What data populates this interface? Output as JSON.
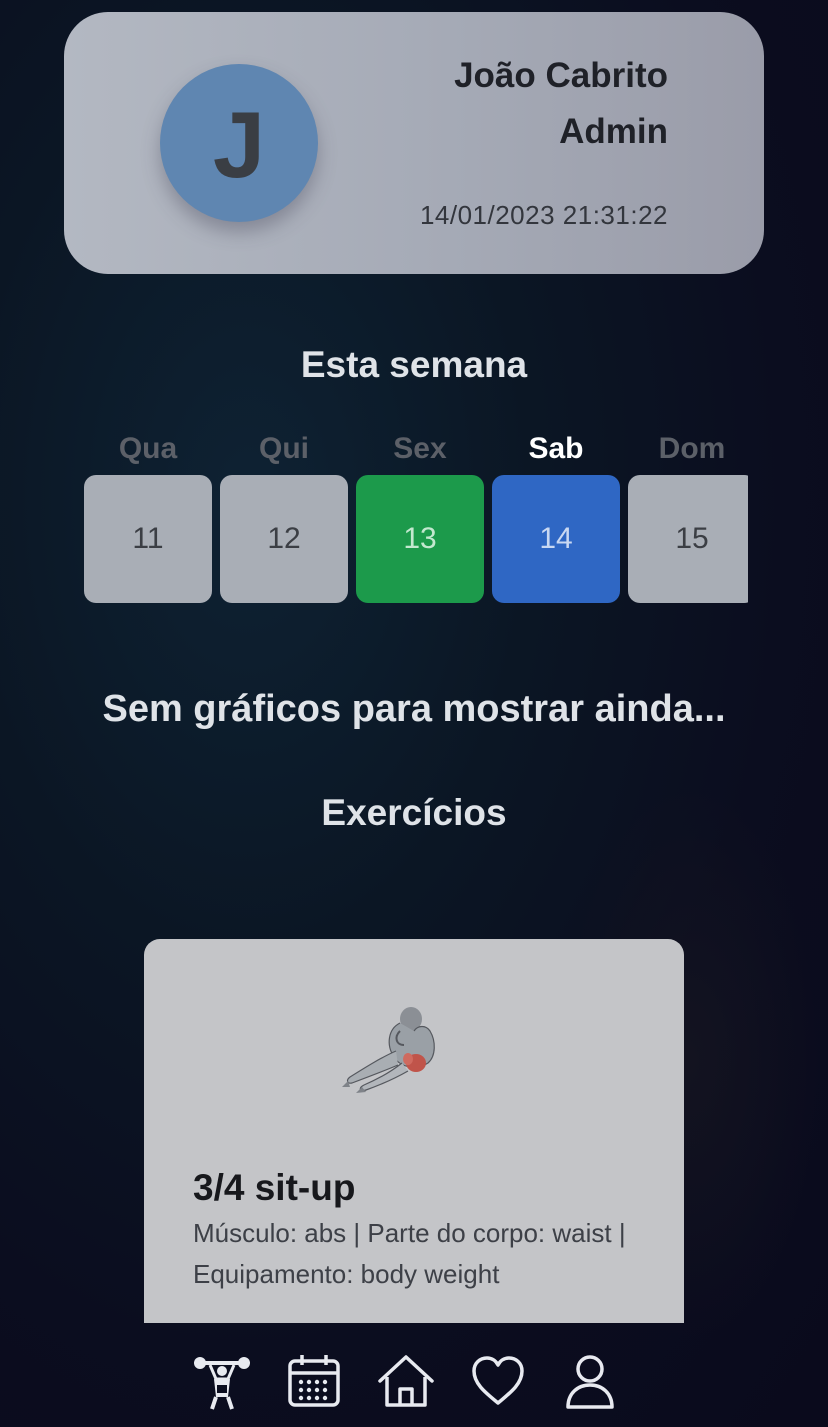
{
  "profile": {
    "initial": "J",
    "name": "João Cabrito",
    "role": "Admin",
    "datetime": "14/01/2023 21:31:22"
  },
  "week": {
    "title": "Esta semana",
    "days": [
      {
        "label": "Qua",
        "number": "11",
        "state": "default"
      },
      {
        "label": "Qui",
        "number": "12",
        "state": "default"
      },
      {
        "label": "Sex",
        "number": "13",
        "state": "done"
      },
      {
        "label": "Sab",
        "number": "14",
        "state": "today"
      },
      {
        "label": "Dom",
        "number": "15",
        "state": "default"
      }
    ]
  },
  "charts": {
    "empty_message": "Sem gráficos para mostrar ainda..."
  },
  "exercises": {
    "title": "Exercícios",
    "items": [
      {
        "name": "3/4 sit-up",
        "description": "Músculo: abs | Parte do corpo: waist | Equipamento: body weight"
      }
    ]
  },
  "nav": {
    "items": [
      {
        "icon": "weightlifter-icon",
        "active": true
      },
      {
        "icon": "calendar-icon",
        "active": false
      },
      {
        "icon": "home-icon",
        "active": false
      },
      {
        "icon": "heart-icon",
        "active": false
      },
      {
        "icon": "user-icon",
        "active": false
      }
    ]
  },
  "colors": {
    "done": "#1c9a4b",
    "today": "#2f67c4",
    "avatar": "#5f86b1"
  }
}
